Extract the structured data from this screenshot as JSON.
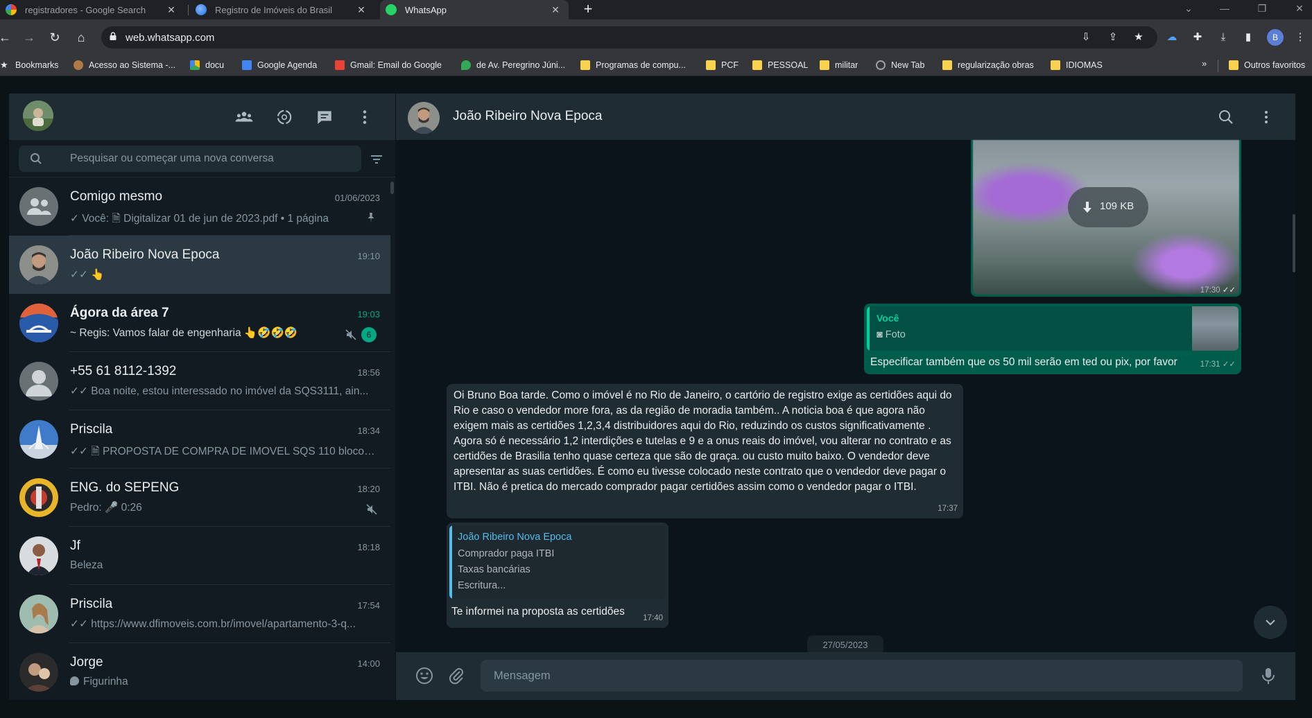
{
  "browser": {
    "tabs": [
      {
        "title": "registradores - Google Search",
        "active": false
      },
      {
        "title": "Registro de Imóveis do Brasil",
        "active": false
      },
      {
        "title": "WhatsApp",
        "active": true
      }
    ],
    "url": "web.whatsapp.com",
    "bookmarks": [
      {
        "label": "Bookmarks",
        "icon": "star-icon"
      },
      {
        "label": "Acesso ao Sistema -...",
        "icon": "site-icon"
      },
      {
        "label": "docu",
        "icon": "drive-icon"
      },
      {
        "label": "Google Agenda",
        "icon": "calendar-icon"
      },
      {
        "label": "Gmail: Email do Google",
        "icon": "gmail-icon"
      },
      {
        "label": "de Av. Peregrino Júni...",
        "icon": "maps-icon"
      },
      {
        "label": "Programas de compu...",
        "icon": "folder-icon"
      },
      {
        "label": "PCF",
        "icon": "folder-icon"
      },
      {
        "label": "PESSOAL",
        "icon": "folder-icon"
      },
      {
        "label": "militar",
        "icon": "folder-icon"
      },
      {
        "label": "New Tab",
        "icon": "globe-icon"
      },
      {
        "label": "regularização obras",
        "icon": "folder-icon"
      },
      {
        "label": "IDIOMAS",
        "icon": "folder-icon"
      }
    ],
    "bookmarks_more": "»",
    "other_bookmarks": "Outros favoritos"
  },
  "sidebar": {
    "search_placeholder": "Pesquisar ou começar uma nova conversa",
    "chats": [
      {
        "name": "Comigo mesmo",
        "time": "01/06/2023",
        "preview": "✓ Você: 🗎 Digitalizar 01 de jun de 2023.pdf • 1 página",
        "pinned": true
      },
      {
        "name": "João Ribeiro Nova Epoca",
        "time": "19:10",
        "preview": "✓✓ 👆",
        "active": true
      },
      {
        "name": "Ágora da área 7",
        "time": "19:03",
        "preview": "~ Regis: Vamos falar de engenharia 👆🤣🤣🤣",
        "muted": true,
        "unread": "6"
      },
      {
        "name": "+55 61 8112-1392",
        "time": "18:56",
        "preview": "✓✓ Boa noite, estou interessado no imóvel da SQS3111, ain..."
      },
      {
        "name": "Priscila",
        "time": "18:34",
        "preview": "✓✓ 🗎 PROPOSTA DE COMPRA DE IMOVEL SQS 110 bloco a..."
      },
      {
        "name": "ENG. do  SEPENG",
        "time": "18:20",
        "preview": "Pedro: 🎤 0:26",
        "muted": true
      },
      {
        "name": "Jf",
        "time": "18:18",
        "preview": "Beleza"
      },
      {
        "name": "Priscila",
        "time": "17:54",
        "preview": "✓✓ https://www.dfimoveis.com.br/imovel/apartamento-3-q..."
      },
      {
        "name": "Jorge",
        "time": "14:00",
        "preview": "Figurinha"
      }
    ]
  },
  "conversation": {
    "title": "João Ribeiro Nova Epoca",
    "image_message": {
      "size_label": "109 KB",
      "time": "17:30"
    },
    "reply_message": {
      "quote_author": "Você",
      "quote_text": "Foto",
      "text": "Especificar também que os 50 mil serão em ted ou pix, por favor",
      "time": "17:31"
    },
    "long_message": {
      "text": "Oi Bruno Boa tarde. Como o imóvel é no Rio de Janeiro, o cartório de registro exige as certidões aqui do Rio e caso o vendedor more fora, as da região de moradia também.. A noticia boa é que agora não exigem mais as certidões 1,2,3,4 distribuidores aqui do Rio, reduzindo os custos significativamente . Agora só é necessário 1,2 interdições e tutelas e 9 e a onus reais do imóvel, vou alterar no contrato e as certidões de Brasilia tenho quase certeza que são de graça. ou custo muito baixo. O vendedor deve apresentar as suas certidões. É como eu tivesse colocado neste contrato que o vendedor deve pagar o ITBI. Não é pretica do mercado comprador pagar certidões assim como o vendedor pagar o ITBI.",
      "time": "17:37"
    },
    "quoted_reply": {
      "quote_author": "João Ribeiro Nova Epoca",
      "quote_lines": [
        "Comprador paga ITBI",
        "Taxas bancárias",
        "Escritura..."
      ],
      "text": "Te informei na proposta as certidões",
      "time": "17:40"
    },
    "date_chip": "27/05/2023",
    "composer_placeholder": "Mensagem"
  },
  "colors": {
    "accent": "#00a884",
    "outgoing": "#005c4b",
    "incoming": "#202c33",
    "panel": "#111b21"
  }
}
